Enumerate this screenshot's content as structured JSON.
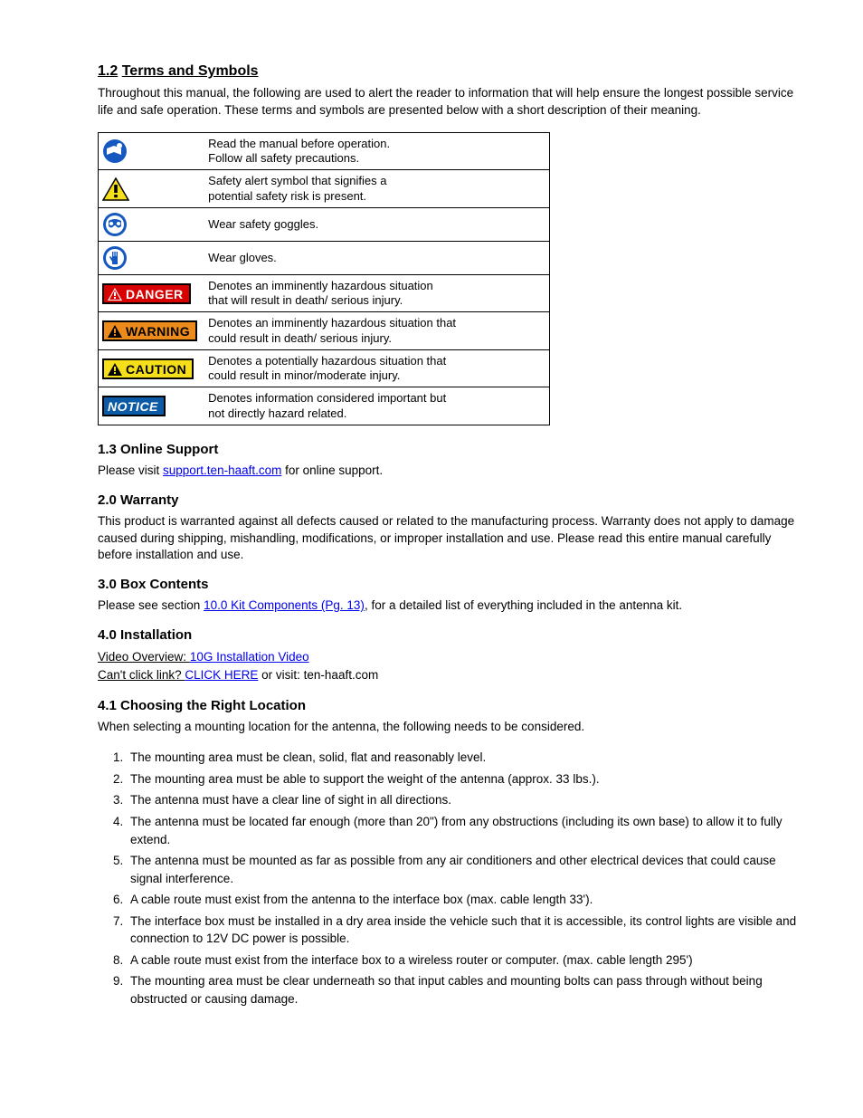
{
  "section": {
    "number": "1.2",
    "title": "Terms and Symbols",
    "intro": "Throughout this manual, the following are used to alert the reader to information that will help ensure the longest possible service life and safe operation. These terms and symbols are presented below with a short description of their meaning."
  },
  "symbols": {
    "rows": [
      {
        "icon": "read-manual-icon",
        "text_left": "Read the manual before operation.",
        "text_right": "Follow all safety precautions.",
        "double": true
      },
      {
        "icon": "alert-tri-icon",
        "text_left": "Safety alert symbol that signifies a",
        "text_right": "potential safety risk is present.",
        "double": true
      },
      {
        "icon": "goggles-icon",
        "text_left": "Wear safety goggles.",
        "double": false
      },
      {
        "icon": "gloves-icon",
        "text_left": "Wear gloves.",
        "double": false
      },
      {
        "icon": "danger-badge",
        "text_left": "Denotes an imminently hazardous situation",
        "text_right": "that will result in death/ serious injury.",
        "double": true
      },
      {
        "icon": "warning-badge",
        "text_left": "Denotes an imminently hazardous situation that",
        "text_right": "could result in death/ serious injury.",
        "double": true
      },
      {
        "icon": "caution-badge",
        "text_left": "Denotes a potentially hazardous situation that",
        "text_right": "could result in minor/moderate injury.",
        "double": true
      },
      {
        "icon": "notice-badge",
        "text_left": "Denotes information considered important but",
        "text_right": "not directly hazard related.",
        "double": true
      }
    ],
    "badges": {
      "danger": "DANGER",
      "warning": "WARNING",
      "caution": "CAUTION",
      "notice": "NOTICE"
    }
  },
  "section13": {
    "heading": "1.3 Online Support",
    "para1_a": "Please visit ",
    "para1_link": "support.ten-haaft.com",
    "para1_b": " for online support."
  },
  "section2": {
    "heading": "2.0 Warranty",
    "para": "This product is warranted against all defects caused or related to the manufacturing process. Warranty does not apply to damage caused during shipping, mishandling, modifications, or improper installation and use. Please read this entire manual carefully before installation and use."
  },
  "section3": {
    "heading": "3.0 Box Contents",
    "para_a": "Please see section ",
    "para_link": "10.0 Kit Components (Pg. 13)",
    "para_b": ", for a detailed list of everything included in the antenna kit."
  },
  "section4": {
    "heading": "4.0 Installation",
    "video": {
      "label": "Video Overview: ",
      "primary_link": "10G Installation Video",
      "fallback_label": "Can't click link? ",
      "fallback_link_text": "CLICK HERE",
      "fallback_b": "or visit: ten-haaft.com"
    },
    "subheading": "4.1 Choosing the Right Location",
    "intro": "When selecting a mounting location for the antenna, the following needs to be considered.",
    "items": [
      "The mounting area must be clean, solid, flat and reasonably level.",
      "The mounting area must be able to support the weight of the antenna (approx. 33 lbs.).",
      "The antenna must have a clear line of sight in all directions.",
      "The antenna must be located far enough (more than 20\") from any obstructions (including its own base) to allow it to fully extend.",
      "The antenna must be mounted as far as possible from any air conditioners and other electrical devices that could cause signal interference.",
      "A cable route must exist from the antenna to the interface box (max. cable length 33').",
      "The interface box must be installed in a dry area inside the vehicle such that it is accessible, its control lights are visible and connection to 12V DC power is possible.",
      "A cable route must exist from the interface box to a wireless router or computer. (max. cable length 295')",
      "The mounting area must be clear underneath so that input cables and mounting bolts can pass through without being obstructed or causing damage."
    ]
  }
}
